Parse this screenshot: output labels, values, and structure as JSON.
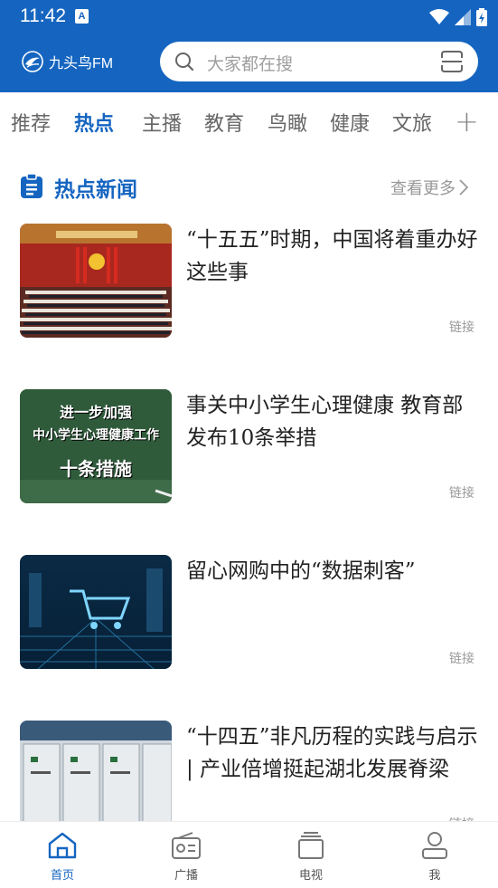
{
  "status_bar": {
    "time": "11:42",
    "notification_icon": "A"
  },
  "header": {
    "logo_text": "九头鸟FM",
    "search_placeholder": "大家都在搜"
  },
  "tabs": [
    {
      "label": "推荐"
    },
    {
      "label": "热点"
    },
    {
      "label": "主播"
    },
    {
      "label": "教育"
    },
    {
      "label": "鸟瞰"
    },
    {
      "label": "健康"
    },
    {
      "label": "文旅"
    }
  ],
  "tab_add_label": "+",
  "section": {
    "title": "热点新闻",
    "more": "查看更多"
  },
  "news": [
    {
      "title": "“十五五”时期，中国将着重办好这些事",
      "link": "链接",
      "thumb_icon": "conference-hall-photo"
    },
    {
      "title": "事关中小学生心理健康 教育部发布10条举措",
      "link": "链接",
      "thumb_icon": "chalkboard-photo",
      "thumb_text": {
        "line1": "进一步加强",
        "line2": "中小学生心理健康工作",
        "line3": "十条措施"
      }
    },
    {
      "title": "留心网购中的“数据刺客”",
      "link": "链接",
      "thumb_icon": "digital-cart-photo"
    },
    {
      "title": "“十四五”非凡历程的实践与启示 | 产业倍增挺起湖北发展脊梁",
      "link": "链接",
      "thumb_icon": "factory-equipment-photo"
    }
  ],
  "bottom_nav": [
    {
      "label": "首页",
      "icon": "home-icon"
    },
    {
      "label": "广播",
      "icon": "radio-icon"
    },
    {
      "label": "电视",
      "icon": "tv-icon"
    },
    {
      "label": "我",
      "icon": "profile-icon"
    }
  ],
  "colors": {
    "primary": "#1565c0",
    "text": "#222222",
    "muted": "#999999"
  }
}
